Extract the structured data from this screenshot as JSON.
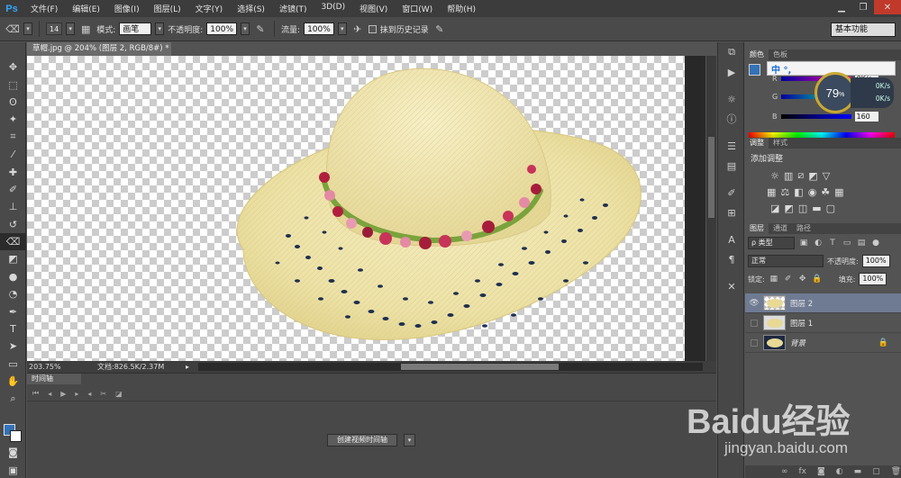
{
  "app": {
    "logo": "Ps"
  },
  "menu": [
    "文件(F)",
    "编辑(E)",
    "图像(I)",
    "图层(L)",
    "文字(Y)",
    "选择(S)",
    "滤镜(T)",
    "3D(D)",
    "视图(V)",
    "窗口(W)",
    "帮助(H)"
  ],
  "window_controls": {
    "minimize": "▁",
    "restore": "❐",
    "close": "✕"
  },
  "options": {
    "brush_size": "14",
    "mode_label": "模式:",
    "mode_value": "画笔",
    "opacity_label": "不透明度:",
    "opacity_value": "100%",
    "flow_label": "流量:",
    "flow_value": "100%",
    "history_label": "抹到历史记录",
    "workspace": "基本功能"
  },
  "document": {
    "tab_title": "草帽.jpg @ 204% (图层 2, RGB/8#) *",
    "zoom": "203.75%",
    "doc_size": "文档:826.5K/2.37M"
  },
  "timeline": {
    "tab": "时间轴",
    "create_video_label": "创建视频时间轴"
  },
  "color_panel": {
    "tabs": [
      "颜色",
      "色板"
    ],
    "rows": [
      {
        "label": "R",
        "value": "0K/s"
      },
      {
        "label": "G",
        "value": "0K/s"
      },
      {
        "label": "B",
        "value": "160"
      }
    ],
    "fg_color": "#3472b8",
    "ime_text": "中 °,"
  },
  "speed_widget": {
    "percent": "79",
    "unit": "%"
  },
  "adjustments": {
    "tabs": [
      "调整",
      "样式"
    ],
    "title": "添加调整"
  },
  "layers": {
    "tabs": [
      "图层",
      "通道",
      "路径"
    ],
    "kind_label": "ρ 类型",
    "blend_mode": "正常",
    "opacity_label": "不透明度:",
    "opacity_value": "100%",
    "lock_label": "锁定:",
    "fill_label": "填充:",
    "fill_value": "100%",
    "items": [
      {
        "name": "图层 2",
        "visible": true,
        "selected": true,
        "locked": false,
        "thumb": "transparent"
      },
      {
        "name": "图层 1",
        "visible": false,
        "selected": false,
        "locked": false,
        "thumb": "normal"
      },
      {
        "name": "背景",
        "visible": false,
        "selected": false,
        "locked": true,
        "thumb": "dark"
      }
    ]
  },
  "watermark": {
    "main": "Baidu经验",
    "sub": "jingyan.baidu.com"
  }
}
